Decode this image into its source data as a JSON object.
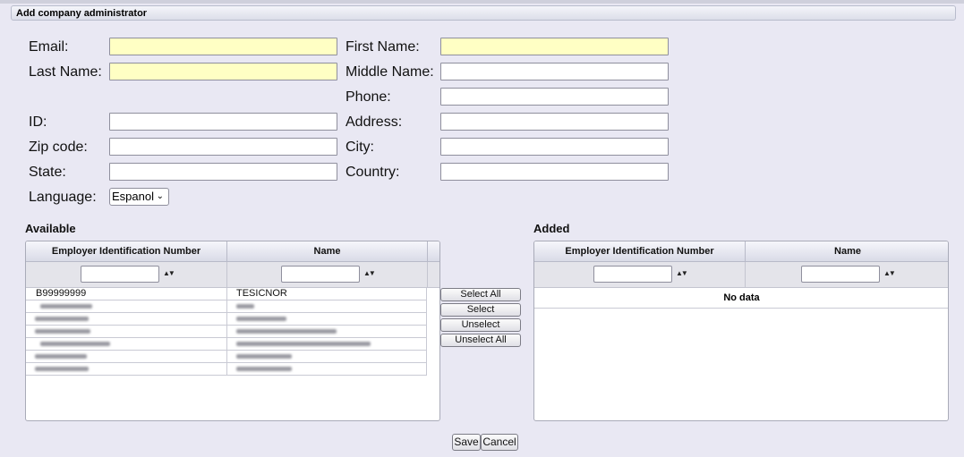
{
  "window": {
    "title": "Add company administrator"
  },
  "form": {
    "email_label": "Email:",
    "first_name_label": "First Name:",
    "last_name_label": "Last Name:",
    "middle_name_label": "Middle Name:",
    "phone_label": "Phone:",
    "id_label": "ID:",
    "address_label": "Address:",
    "zip_label": "Zip code:",
    "city_label": "City:",
    "state_label": "State:",
    "country_label": "Country:",
    "language_label": "Language:",
    "language_value": "Espanol",
    "values": {
      "email": "",
      "first_name": "",
      "last_name": "",
      "middle_name": "",
      "phone": "",
      "id": "",
      "address": "",
      "zip": "",
      "city": "",
      "state": "",
      "country": ""
    },
    "required_color": "#ffffc4"
  },
  "available": {
    "title": "Available",
    "columns": [
      "Employer Identification Number",
      "Name"
    ],
    "rows": [
      {
        "ein": "B99999999",
        "name": "TESICNOR"
      }
    ],
    "redacted_rows": 6
  },
  "transfer_buttons": {
    "select_all": "Select All",
    "select": "Select",
    "unselect": "Unselect",
    "unselect_all": "Unselect All"
  },
  "added": {
    "title": "Added",
    "columns": [
      "Employer Identification Number",
      "Name"
    ],
    "empty_text": "No data"
  },
  "footer": {
    "save": "Save",
    "cancel": "Cancel"
  },
  "icons": {
    "sort": "sort-arrows-icon",
    "dropdown": "chevron-down-icon"
  }
}
